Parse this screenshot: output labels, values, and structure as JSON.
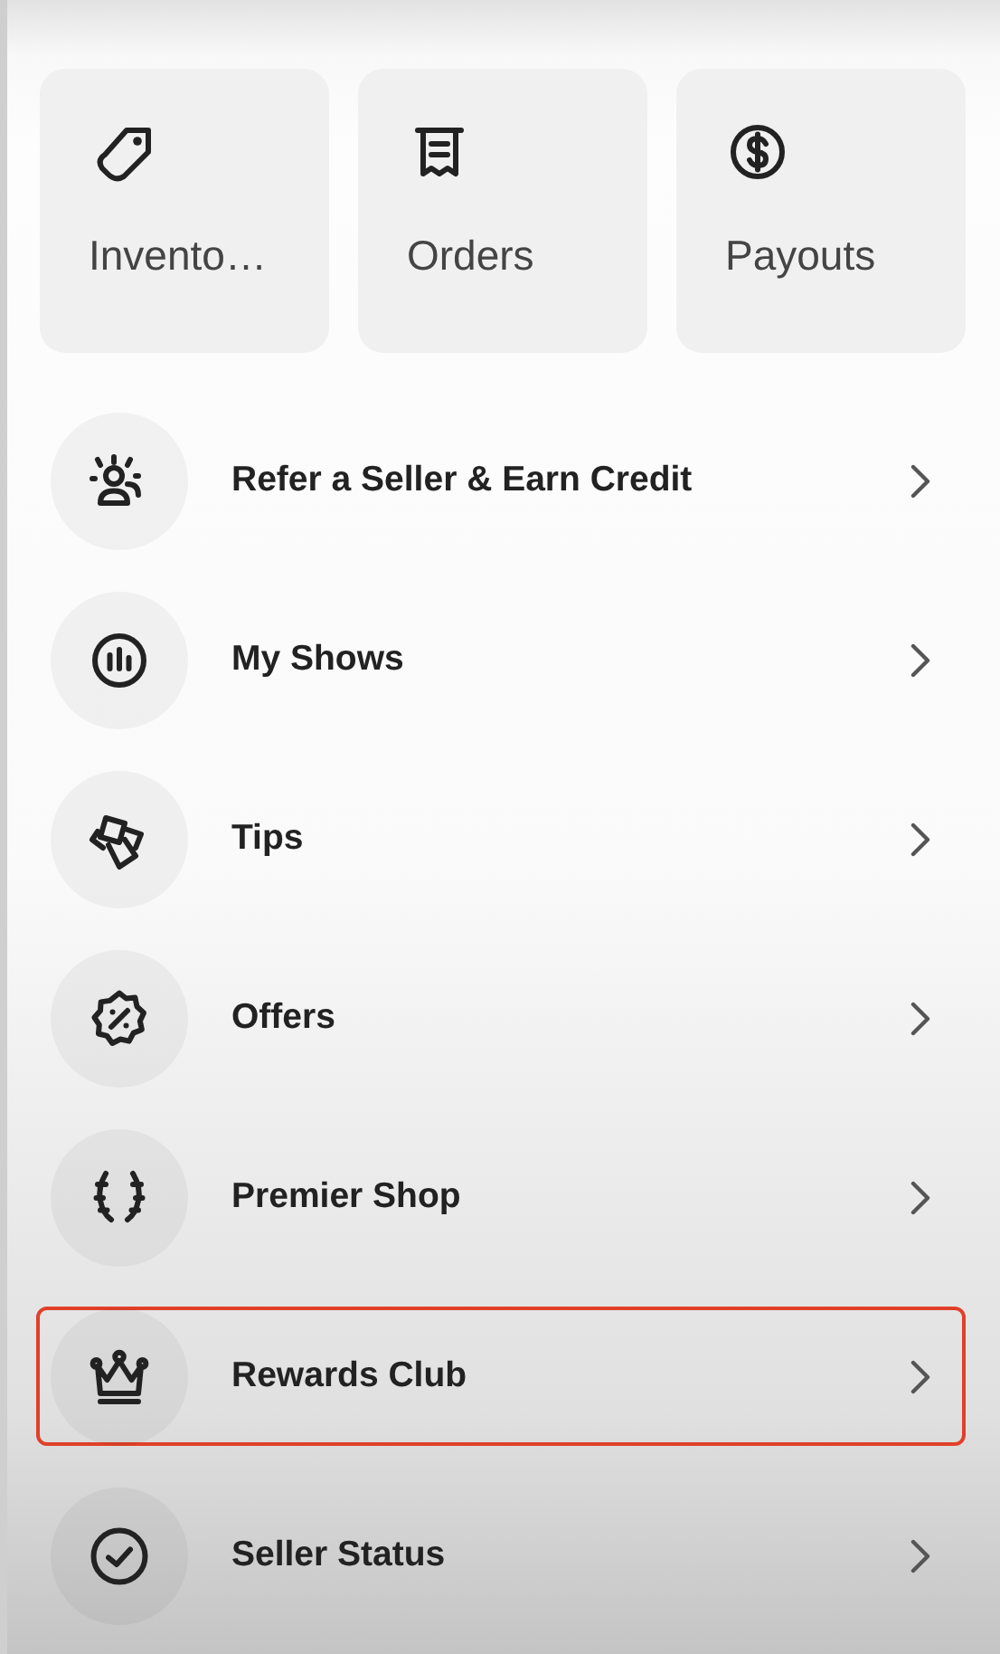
{
  "shortcuts": [
    {
      "label": "Invento…"
    },
    {
      "label": "Orders"
    },
    {
      "label": "Payouts"
    }
  ],
  "menu": [
    {
      "label": "Refer a Seller & Earn Credit",
      "highlighted": false
    },
    {
      "label": "My Shows",
      "highlighted": false
    },
    {
      "label": "Tips",
      "highlighted": false
    },
    {
      "label": "Offers",
      "highlighted": false
    },
    {
      "label": "Premier Shop",
      "highlighted": false
    },
    {
      "label": "Rewards Club",
      "highlighted": true
    },
    {
      "label": "Seller Status",
      "highlighted": false
    }
  ]
}
